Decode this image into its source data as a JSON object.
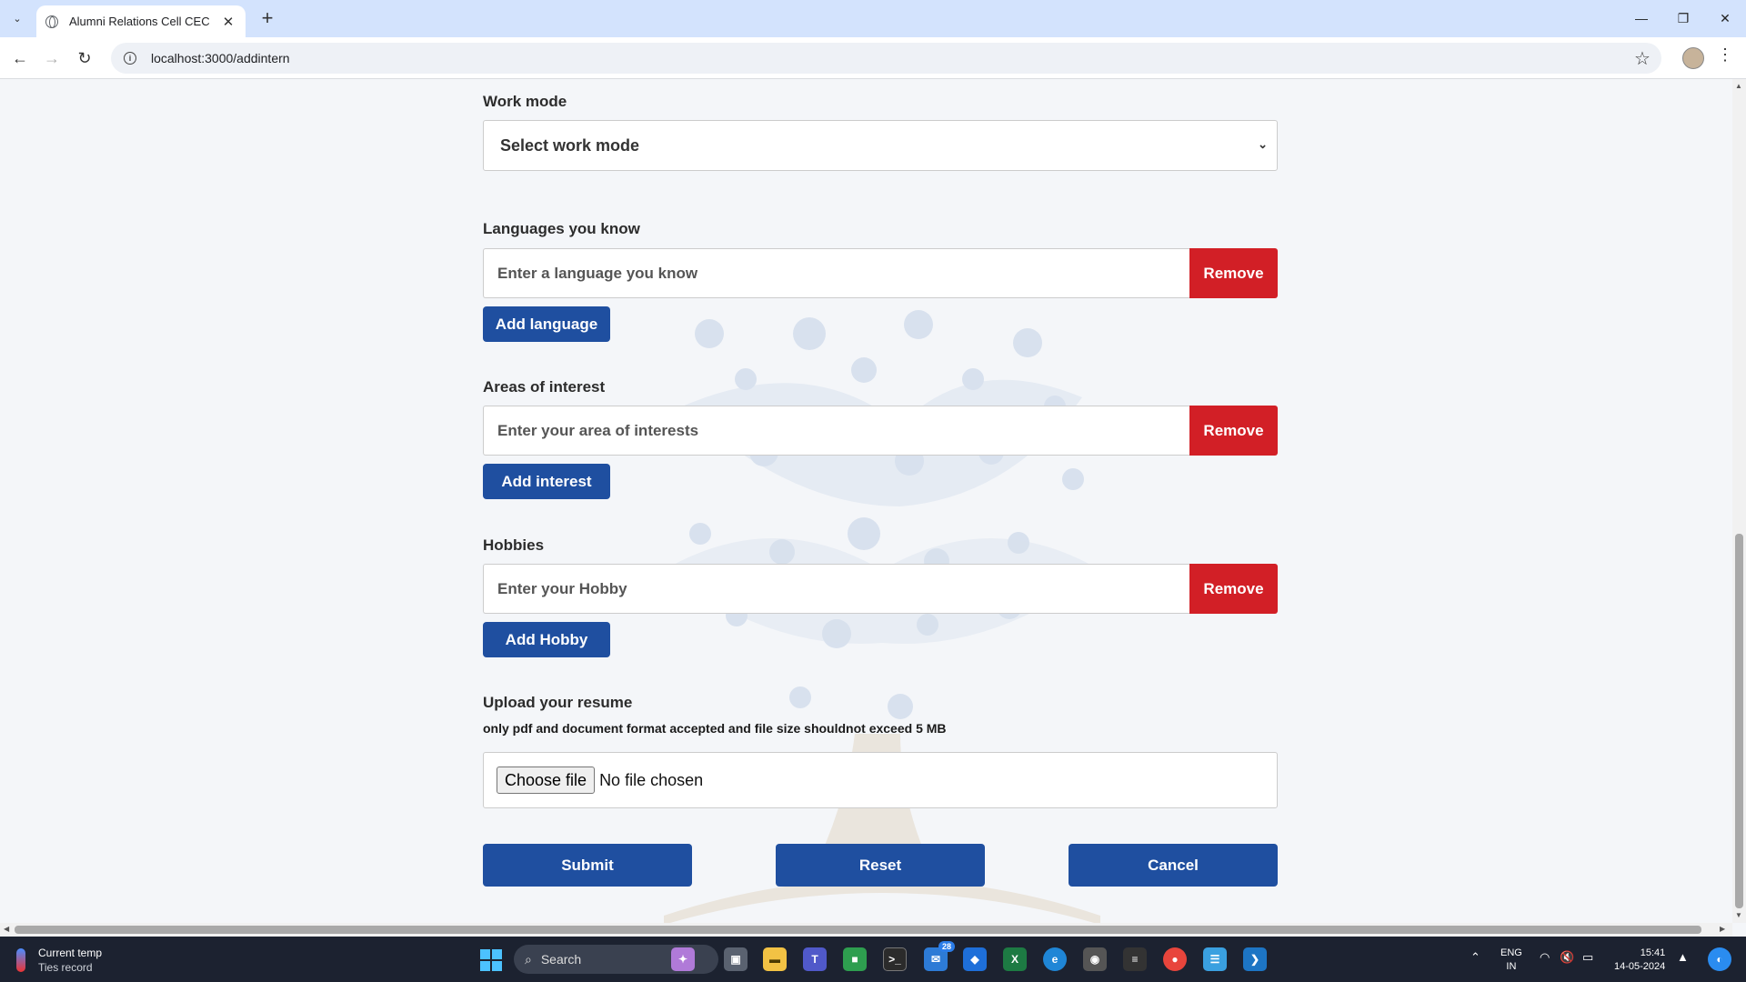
{
  "browser": {
    "tab_title": "Alumni Relations Cell CEC",
    "url": "localhost:3000/addintern"
  },
  "form": {
    "work_mode": {
      "label": "Work mode",
      "selected": "Select work mode"
    },
    "languages": {
      "label": "Languages you know",
      "placeholder": "Enter a language you know",
      "remove_label": "Remove",
      "add_label": "Add language"
    },
    "interests": {
      "label": "Areas of interest",
      "placeholder": "Enter your area of interests",
      "remove_label": "Remove",
      "add_label": "Add interest"
    },
    "hobbies": {
      "label": "Hobbies",
      "placeholder": "Enter your Hobby",
      "remove_label": "Remove",
      "add_label": "Add Hobby"
    },
    "resume": {
      "label": "Upload your resume",
      "hint": "only pdf and document format accepted and file size shouldnot exceed 5 MB",
      "choose_label": "Choose file",
      "status": "No file chosen"
    },
    "actions": {
      "submit": "Submit",
      "reset": "Reset",
      "cancel": "Cancel"
    }
  },
  "taskbar": {
    "weather_title": "Current temp",
    "weather_sub": "Ties record",
    "search_label": "Search",
    "mail_badge": "28",
    "lang_top": "ENG",
    "lang_bottom": "IN",
    "time": "15:41",
    "date": "14-05-2024"
  },
  "colors": {
    "primary_button": "#1f4fa0",
    "remove_button": "#d21f26",
    "page_bg": "#f4f6f9",
    "tabbar_bg": "#d3e3fd"
  }
}
